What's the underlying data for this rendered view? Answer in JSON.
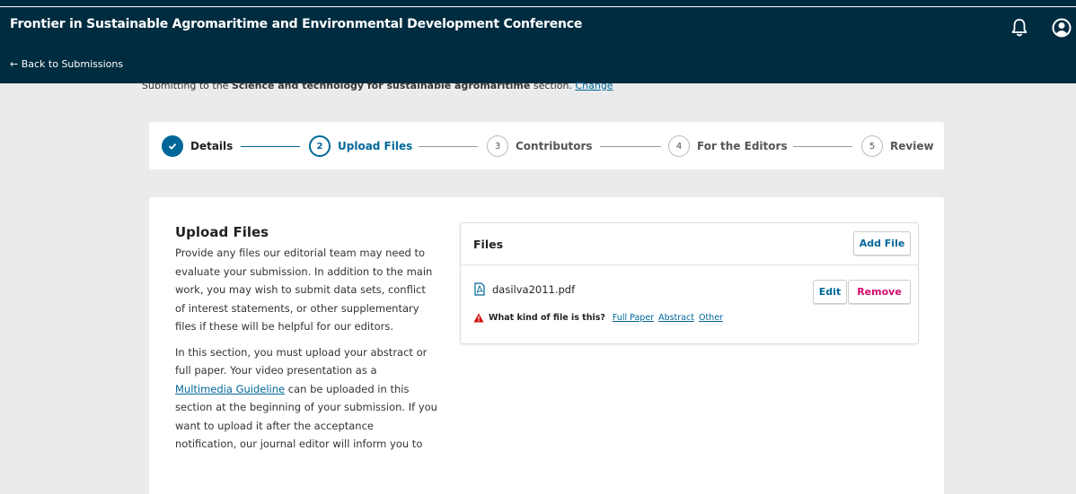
{
  "header": {
    "site_title": "Frontier in Sustainable Agromaritime and Environmental Development Conference",
    "back_label": "← Back to Submissions",
    "icons": [
      "bell-icon",
      "user-icon"
    ]
  },
  "submitting": {
    "prefix": "Submitting to the ",
    "section": "Science and technology for sustainable agromaritime",
    "suffix": " section. ",
    "change_label": "Change"
  },
  "steps": [
    {
      "number": "",
      "label": "Details",
      "state": "done"
    },
    {
      "number": "2",
      "label": "Upload Files",
      "state": "current"
    },
    {
      "number": "3",
      "label": "Contributors",
      "state": "pending"
    },
    {
      "number": "4",
      "label": "For the Editors",
      "state": "pending"
    },
    {
      "number": "5",
      "label": "Review",
      "state": "pending"
    }
  ],
  "upload": {
    "title": "Upload Files",
    "paragraph1": "Provide any files our editorial team may need to evaluate your submission. In addition to the main work, you may wish to submit data sets, conflict of interest statements, or other supplementary files if these will be helpful for our editors.",
    "paragraph2_before": "In this section, you must upload your abstract or full paper. Your video presentation as a ",
    "paragraph2_link": "Multimedia Guideline",
    "paragraph2_after": " can be uploaded in this section at the beginning of your submission. If you want to upload it after the acceptance notification, our journal editor will inform you to"
  },
  "files_panel": {
    "title": "Files",
    "add_label": "Add File",
    "file_name": "dasilva2011.pdf",
    "edit_label": "Edit",
    "remove_label": "Remove",
    "question": "What kind of file is this?",
    "options": [
      "Full Paper",
      "Abstract",
      "Other"
    ]
  },
  "colors": {
    "header_bg": "#002c40",
    "accent": "#006798",
    "danger": "#d00a6c",
    "page_bg": "#e9ebed"
  }
}
